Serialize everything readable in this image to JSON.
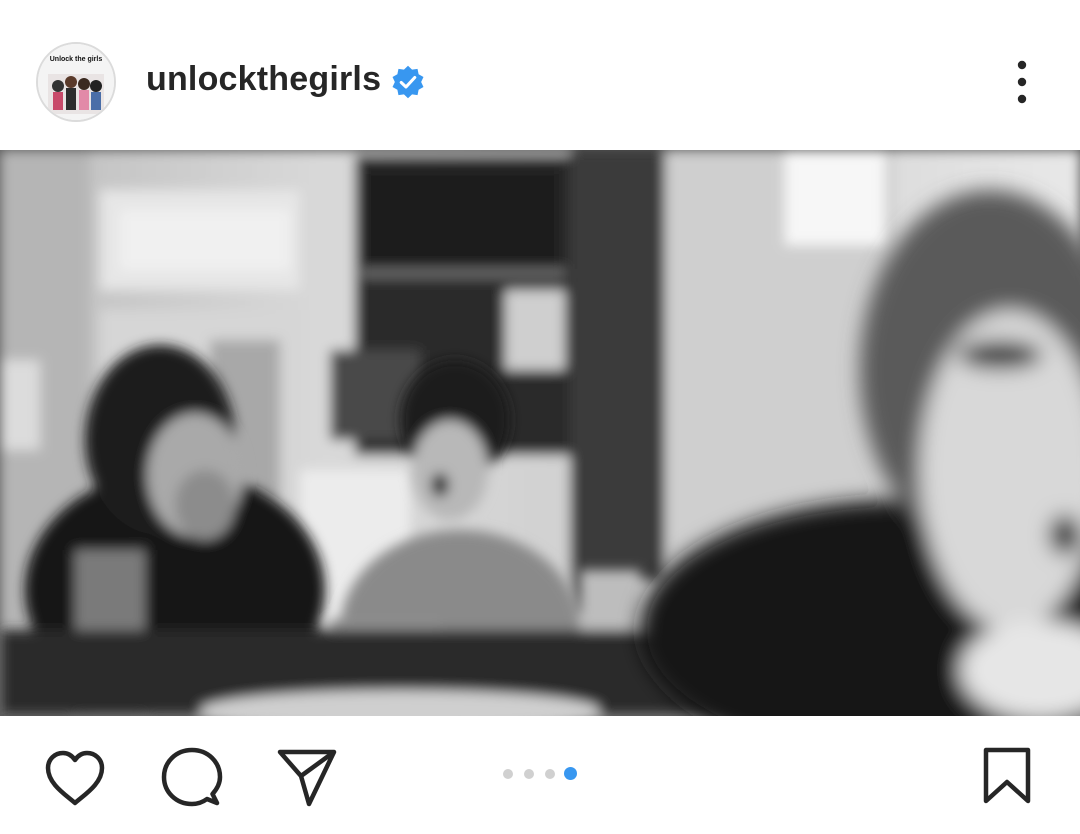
{
  "post": {
    "username": "unlockthegirls",
    "verified": true,
    "avatar_text": "Unlock the girls",
    "more_icon": "more-vertical-icon"
  },
  "carousel": {
    "total_slides": 4,
    "active_index": 3
  },
  "actions": {
    "like_icon": "heart-icon",
    "comment_icon": "comment-icon",
    "share_icon": "send-icon",
    "save_icon": "bookmark-icon"
  },
  "colors": {
    "verified_blue": "#3897f0",
    "active_dot": "#3897f0",
    "inactive_dot": "#d0d0d0",
    "text": "#262626"
  }
}
